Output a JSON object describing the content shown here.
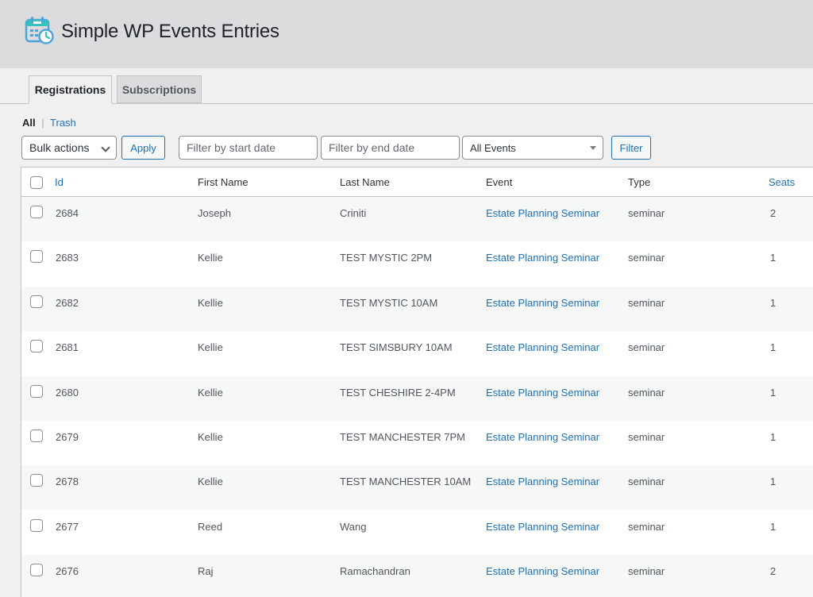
{
  "header": {
    "title": "Simple WP Events Entries",
    "logo_icon": "calendar-clock-icon"
  },
  "tabs": [
    {
      "label": "Registrations",
      "active": true
    },
    {
      "label": "Subscriptions",
      "active": false
    }
  ],
  "views": {
    "all": "All",
    "separator": "|",
    "trash": "Trash"
  },
  "toolbar": {
    "bulk_actions": "Bulk actions",
    "apply": "Apply",
    "start_placeholder": "Filter by start date",
    "end_placeholder": "Filter by end date",
    "events_selected": "All Events",
    "filter": "Filter"
  },
  "table": {
    "columns": [
      "Id",
      "First Name",
      "Last Name",
      "Event",
      "Type",
      "Seats"
    ],
    "rows": [
      {
        "id": "2684",
        "first": "Joseph",
        "last": "Criniti",
        "event": "Estate Planning Seminar",
        "type": "seminar",
        "seats": "2"
      },
      {
        "id": "2683",
        "first": "Kellie",
        "last": "TEST MYSTIC 2PM",
        "event": "Estate Planning Seminar",
        "type": "seminar",
        "seats": "1"
      },
      {
        "id": "2682",
        "first": "Kellie",
        "last": "TEST MYSTIC 10AM",
        "event": "Estate Planning Seminar",
        "type": "seminar",
        "seats": "1"
      },
      {
        "id": "2681",
        "first": "Kellie",
        "last": "TEST SIMSBURY 10AM",
        "event": "Estate Planning Seminar",
        "type": "seminar",
        "seats": "1"
      },
      {
        "id": "2680",
        "first": "Kellie",
        "last": "TEST CHESHIRE 2-4PM",
        "event": "Estate Planning Seminar",
        "type": "seminar",
        "seats": "1"
      },
      {
        "id": "2679",
        "first": "Kellie",
        "last": "TEST MANCHESTER 7PM",
        "event": "Estate Planning Seminar",
        "type": "seminar",
        "seats": "1"
      },
      {
        "id": "2678",
        "first": "Kellie",
        "last": "TEST MANCHESTER 10AM",
        "event": "Estate Planning Seminar",
        "type": "seminar",
        "seats": "1"
      },
      {
        "id": "2677",
        "first": "Reed",
        "last": "Wang",
        "event": "Estate Planning Seminar",
        "type": "seminar",
        "seats": "1"
      },
      {
        "id": "2676",
        "first": "Raj",
        "last": "Ramachandran",
        "event": "Estate Planning Seminar",
        "type": "seminar",
        "seats": "2"
      }
    ]
  }
}
